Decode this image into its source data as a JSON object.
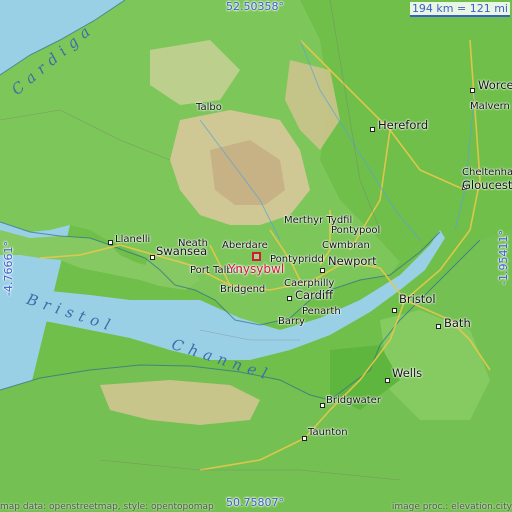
{
  "map": {
    "target": {
      "name": "Ynysybwl"
    },
    "scale_label": "194 km = 121 mi",
    "coords": {
      "top": "52.50358°",
      "bottom": "50.75807°",
      "left": "-4.76661°",
      "right": "-1.95411°"
    },
    "footer": {
      "left": "map data: openstreetmap, style: opentopomap",
      "right": "image proc.: elevation.city"
    },
    "water_labels": {
      "cardigan": "Cardiga",
      "bristol": "Bristol",
      "channel": "Channel"
    },
    "places": [
      {
        "id": "worcester",
        "name": "Worce"
      },
      {
        "id": "malvern",
        "name": "Malvern"
      },
      {
        "id": "hereford",
        "name": "Hereford"
      },
      {
        "id": "cheltenham",
        "name": "Cheltenham"
      },
      {
        "id": "gloucester",
        "name": "Glouceste"
      },
      {
        "id": "merthyr",
        "name": "Merthyr Tydfil"
      },
      {
        "id": "pontypool",
        "name": "Pontypool"
      },
      {
        "id": "cwmbran",
        "name": "Cwmbran"
      },
      {
        "id": "aberdare",
        "name": "Aberdare"
      },
      {
        "id": "neath",
        "name": "Neath"
      },
      {
        "id": "llanelli",
        "name": "Llanelli"
      },
      {
        "id": "swansea",
        "name": "Swansea"
      },
      {
        "id": "pontypridd",
        "name": "Pontypridd"
      },
      {
        "id": "newport",
        "name": "Newport"
      },
      {
        "id": "port_talbot",
        "name": "Port Talbot"
      },
      {
        "id": "talbot_top",
        "name": "Talbo"
      },
      {
        "id": "caerphilly",
        "name": "Caerphilly"
      },
      {
        "id": "bridgend",
        "name": "Bridgend"
      },
      {
        "id": "cardiff",
        "name": "Cardiff"
      },
      {
        "id": "penarth",
        "name": "Penarth"
      },
      {
        "id": "barry",
        "name": "Barry"
      },
      {
        "id": "bristol",
        "name": "Bristol"
      },
      {
        "id": "bath",
        "name": "Bath"
      },
      {
        "id": "wells",
        "name": "Wells"
      },
      {
        "id": "bridgwater",
        "name": "Bridgwater"
      },
      {
        "id": "taunton",
        "name": "Taunton"
      }
    ]
  }
}
